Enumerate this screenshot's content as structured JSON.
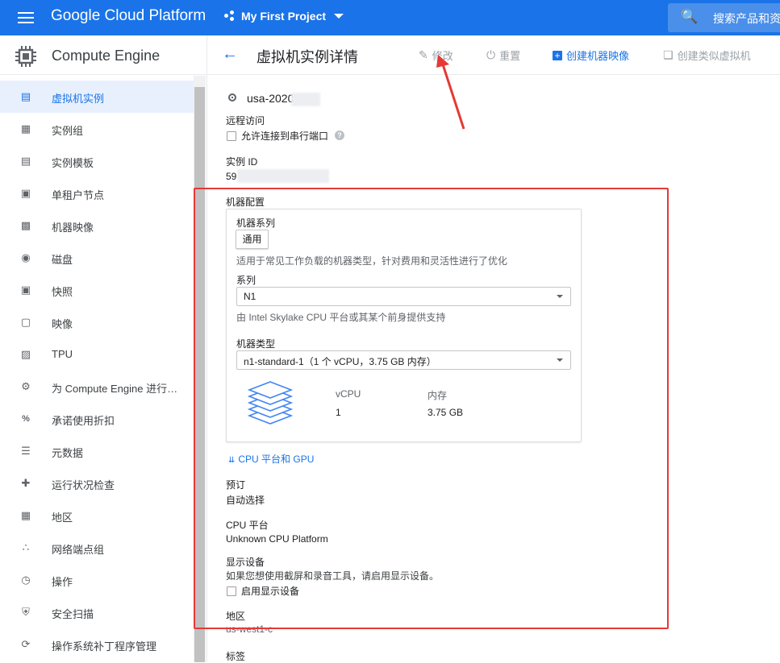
{
  "topbar": {
    "brand": "Google Cloud Platform",
    "project": "My First Project",
    "search_placeholder": "搜索产品和资"
  },
  "sidebar": {
    "title": "Compute Engine",
    "items": [
      {
        "label": "虚拟机实例",
        "icon": "vm-instance-icon",
        "active": true
      },
      {
        "label": "实例组",
        "icon": "instance-group-icon"
      },
      {
        "label": "实例模板",
        "icon": "instance-template-icon"
      },
      {
        "label": "单租户节点",
        "icon": "sole-tenant-icon"
      },
      {
        "label": "机器映像",
        "icon": "machine-image-icon"
      },
      {
        "label": "磁盘",
        "icon": "disk-icon"
      },
      {
        "label": "快照",
        "icon": "snapshot-icon"
      },
      {
        "label": "映像",
        "icon": "image-icon"
      },
      {
        "label": "TPU",
        "icon": "tpu-icon"
      },
      {
        "label": "为 Compute Engine 进行…",
        "icon": "settings-gear-icon"
      },
      {
        "label": "承诺使用折扣",
        "icon": "percent-icon"
      },
      {
        "label": "元数据",
        "icon": "metadata-icon"
      },
      {
        "label": "运行状况检查",
        "icon": "health-check-icon"
      },
      {
        "label": "地区",
        "icon": "zones-icon"
      },
      {
        "label": "网络端点组",
        "icon": "network-endpoint-icon"
      },
      {
        "label": "操作",
        "icon": "clock-icon"
      },
      {
        "label": "安全扫描",
        "icon": "shield-icon"
      },
      {
        "label": "操作系统补丁程序管理",
        "icon": "patch-icon"
      }
    ]
  },
  "header": {
    "title": "虚拟机实例详情",
    "actions": {
      "edit": "修改",
      "reset": "重置",
      "create_image": "创建机器映像",
      "create_similar": "创建类似虚拟机"
    }
  },
  "instance": {
    "name": "usa-2020",
    "remote_access_label": "远程访问",
    "serial_port_label": "允许连接到串行端口",
    "instance_id_label": "实例 ID",
    "instance_id": "59",
    "machine_config_label": "机器配置",
    "machine_family_label": "机器系列",
    "machine_family_button": "通用",
    "family_desc": "适用于常见工作负载的机器类型，针对费用和灵活性进行了优化",
    "series_label": "系列",
    "series_value": "N1",
    "series_desc": "由 Intel Skylake CPU 平台或其某个前身提供支持",
    "machine_type_label": "机器类型",
    "machine_type_value": "n1-standard-1（1 个 vCPU，3.75 GB 内存）",
    "vcpu_label": "vCPU",
    "vcpu_value": "1",
    "memory_label": "内存",
    "memory_value": "3.75 GB",
    "cpu_gpu_link": "CPU 平台和 GPU",
    "reservation_label": "预订",
    "reservation_value": "自动选择",
    "cpu_platform_label": "CPU 平台",
    "cpu_platform_value": "Unknown CPU Platform",
    "display_label": "显示设备",
    "display_desc": "如果您想使用截屏和录音工具，请启用显示设备。",
    "display_checkbox": "启用显示设备",
    "zone_label": "地区",
    "zone_value": "us-west1-c",
    "tags_label": "标签"
  },
  "colors": {
    "topbar": "#1a73e8",
    "accent": "#1a73e8",
    "annotation_red": "#e53935"
  }
}
